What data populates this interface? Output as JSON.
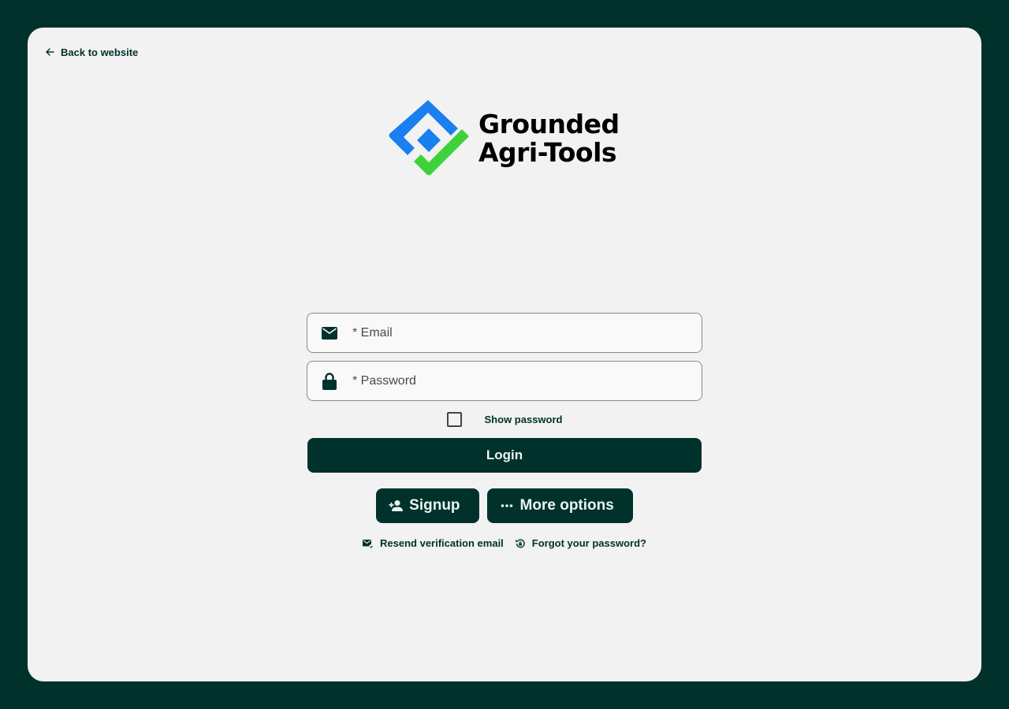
{
  "header": {
    "back_label": "Back to website"
  },
  "logo": {
    "line1": "Grounded",
    "line2": "Agri-Tools"
  },
  "form": {
    "email_placeholder": "* Email",
    "password_placeholder": "* Password",
    "show_password_label": "Show password",
    "login_label": "Login",
    "signup_label": "Signup",
    "more_options_label": "More options",
    "resend_label": "Resend verification email",
    "forgot_label": "Forgot your password?"
  },
  "colors": {
    "background": "#00312b",
    "card": "#f2f2f2",
    "primary": "#00312b",
    "logo_blue": "#1a7ff0",
    "logo_green": "#3fd13a"
  },
  "icons": {
    "back": "arrow-left-icon",
    "email": "envelope-icon",
    "password": "lock-icon",
    "signup": "person-add-icon",
    "more": "more-dots-icon",
    "resend": "mail-check-icon",
    "forgot": "lock-reset-icon"
  }
}
